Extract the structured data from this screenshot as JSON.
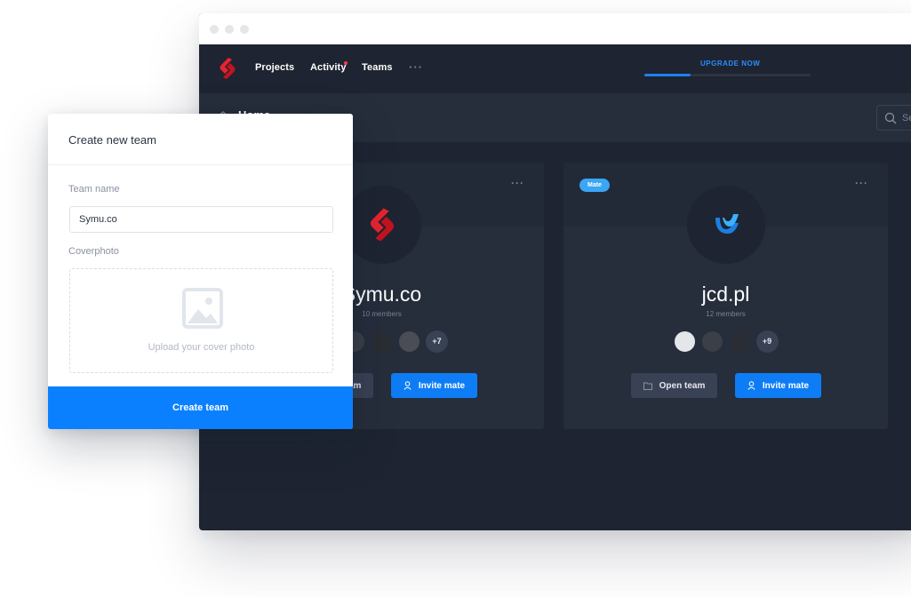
{
  "nav": {
    "items": [
      {
        "label": "Projects"
      },
      {
        "label": "Activity",
        "has_notification": true
      },
      {
        "label": "Teams"
      }
    ],
    "more_label": "···",
    "upgrade_label": "UPGRADE NOW",
    "upgrade_progress": 0.28
  },
  "subbar": {
    "title": "Home",
    "search_placeholder": "Search"
  },
  "cards": [
    {
      "name": "Symu.co",
      "members": "10 members",
      "more_count": "+7",
      "open_label": "Open team",
      "invite_label": "Invite mate",
      "more_label": "···",
      "logo": "symu-logo-icon"
    },
    {
      "badge": "Mate",
      "name": "jcd.pl",
      "members": "12 members",
      "more_count": "+9",
      "open_label": "Open team",
      "invite_label": "Invite mate",
      "more_label": "···",
      "logo": "jcd-logo-icon"
    }
  ],
  "modal": {
    "title": "Create new team",
    "team_name_label": "Team name",
    "team_name_value": "Symu.co",
    "coverphoto_label": "Coverphoto",
    "upload_text": "Upload your cover photo",
    "submit_label": "Create team"
  },
  "colors": {
    "accent": "#0a80ff",
    "app_bg": "#1e2431",
    "card_bg": "#262d3b",
    "badge": "#3aa6f4",
    "brand_red": "#e8232f"
  }
}
